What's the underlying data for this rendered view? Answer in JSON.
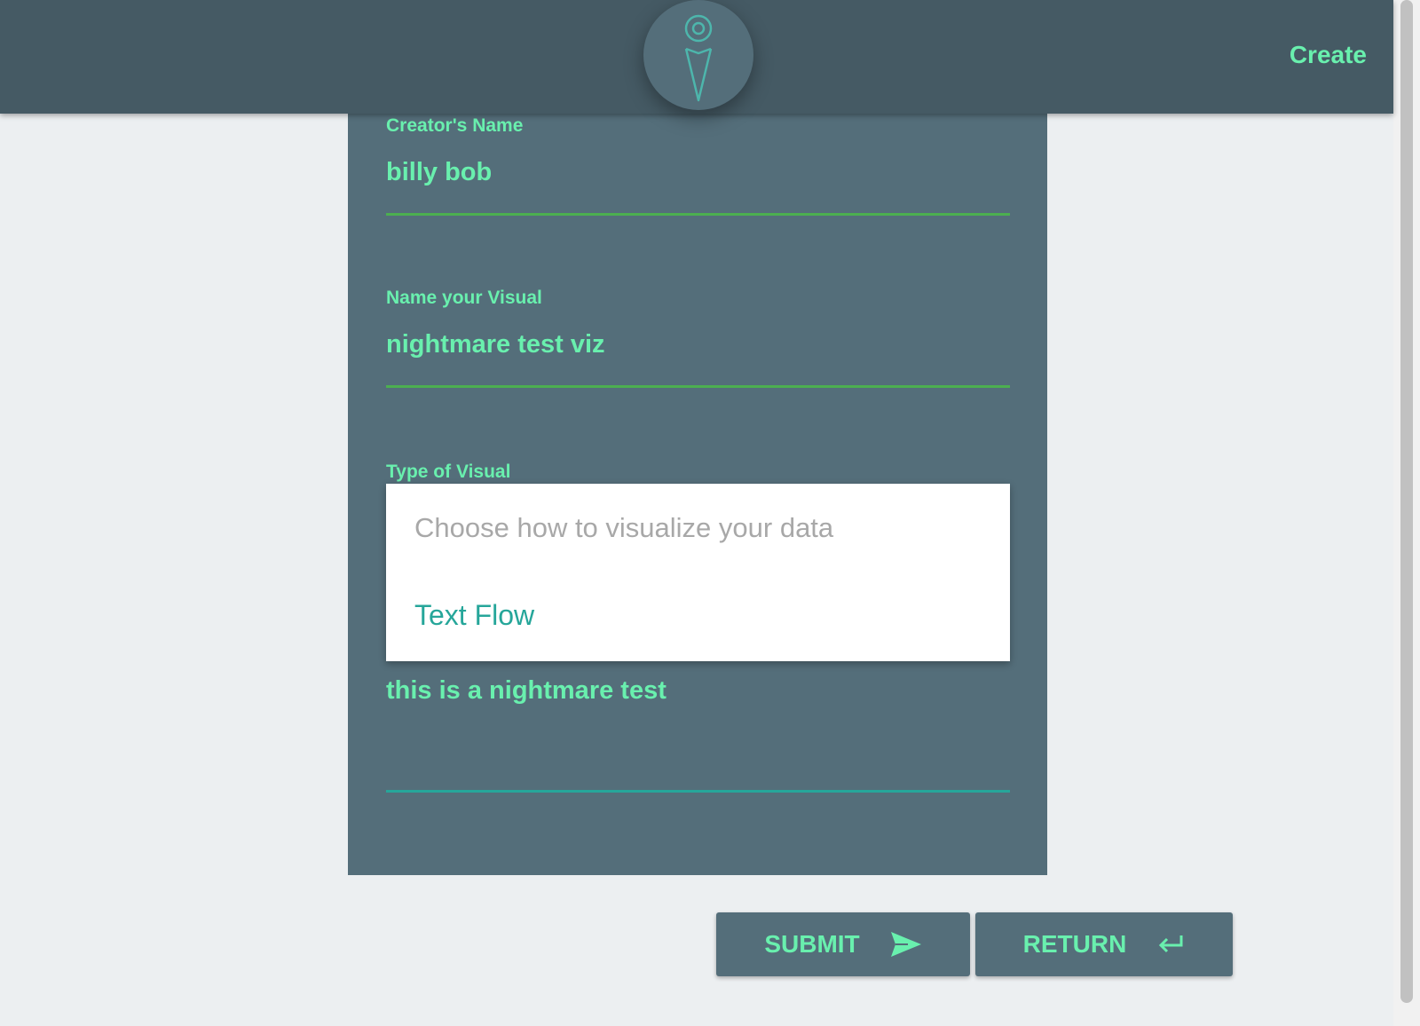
{
  "header": {
    "title": "Create",
    "logo_icon": "ice-cream-cone-icon",
    "background_color": "#455a64",
    "accent_color": "#69f0ae"
  },
  "form": {
    "creator_name": {
      "label": "Creator's Name",
      "value": "billy bob"
    },
    "visual_name": {
      "label": "Name your Visual",
      "value": "nightmare test viz"
    },
    "visual_type": {
      "label": "Type of Visual",
      "placeholder": "Choose how to visualize your data",
      "options": [
        "Text Flow"
      ]
    },
    "description": {
      "value": "this is a nightmare test"
    }
  },
  "actions": {
    "submit_label": "SUBMIT",
    "submit_icon": "send-icon",
    "return_label": "RETURN",
    "return_icon": "return-arrow-icon"
  }
}
